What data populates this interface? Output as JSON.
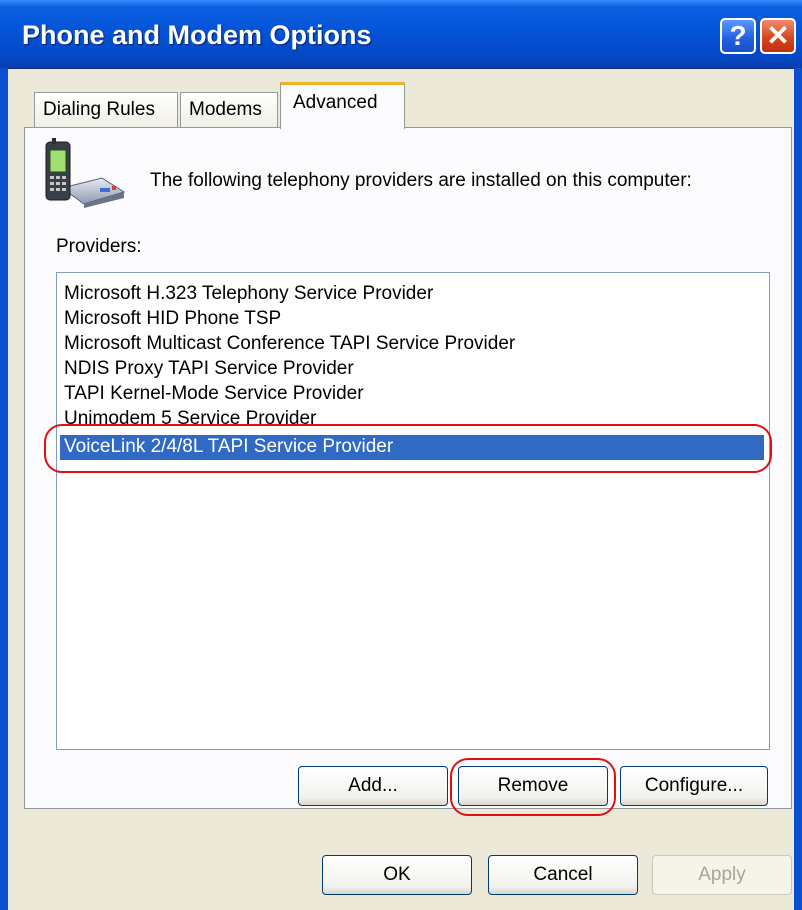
{
  "window": {
    "title": "Phone and Modem Options"
  },
  "titlebar": {
    "help_glyph": "?",
    "close_glyph": "✕"
  },
  "tabs": [
    {
      "label": "Dialing Rules"
    },
    {
      "label": "Modems"
    },
    {
      "label": "Advanced"
    }
  ],
  "advanced": {
    "intro": "The following telephony providers are installed on this computer:",
    "providers_label": "Providers:",
    "providers": [
      "Microsoft H.323 Telephony Service Provider",
      "Microsoft HID Phone TSP",
      "Microsoft Multicast Conference TAPI Service Provider",
      "NDIS Proxy TAPI Service Provider",
      "TAPI Kernel-Mode Service Provider",
      "Unimodem 5 Service Provider",
      "VoiceLink 2/4/8L TAPI Service Provider"
    ],
    "selected_provider": "VoiceLink 2/4/8L TAPI Service Provider",
    "buttons": {
      "add": "Add...",
      "remove": "Remove",
      "configure": "Configure..."
    }
  },
  "footer": {
    "ok": "OK",
    "cancel": "Cancel",
    "apply": "Apply"
  },
  "colors": {
    "selection": "#316ac5",
    "annotation": "#e01010",
    "titlebar": "#0453d8"
  },
  "icons": {
    "header": "phone-modem-icon"
  }
}
